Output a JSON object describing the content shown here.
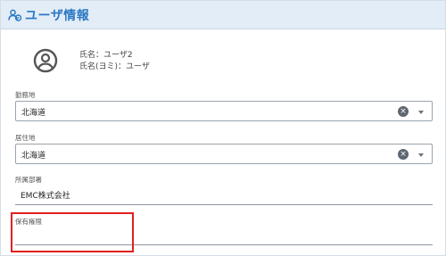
{
  "header": {
    "title": "ユーザ情報",
    "icon": "user-group-icon",
    "accent_color": "#2c78c4",
    "background_color": "#e3edf7"
  },
  "user": {
    "avatar_icon": "user-circle-icon",
    "name_line": "氏名：ユーザ2",
    "kana_line": "氏名(ヨミ)：ユーザ"
  },
  "fields": {
    "workplace": {
      "label": "勤務地",
      "value": "北海道"
    },
    "residence": {
      "label": "居住地",
      "value": "北海道"
    },
    "department": {
      "label": "所属部署",
      "value": "EMC株式会社"
    },
    "permissions": {
      "label": "保有権限",
      "value": ""
    }
  },
  "highlight_color": "#e02020"
}
